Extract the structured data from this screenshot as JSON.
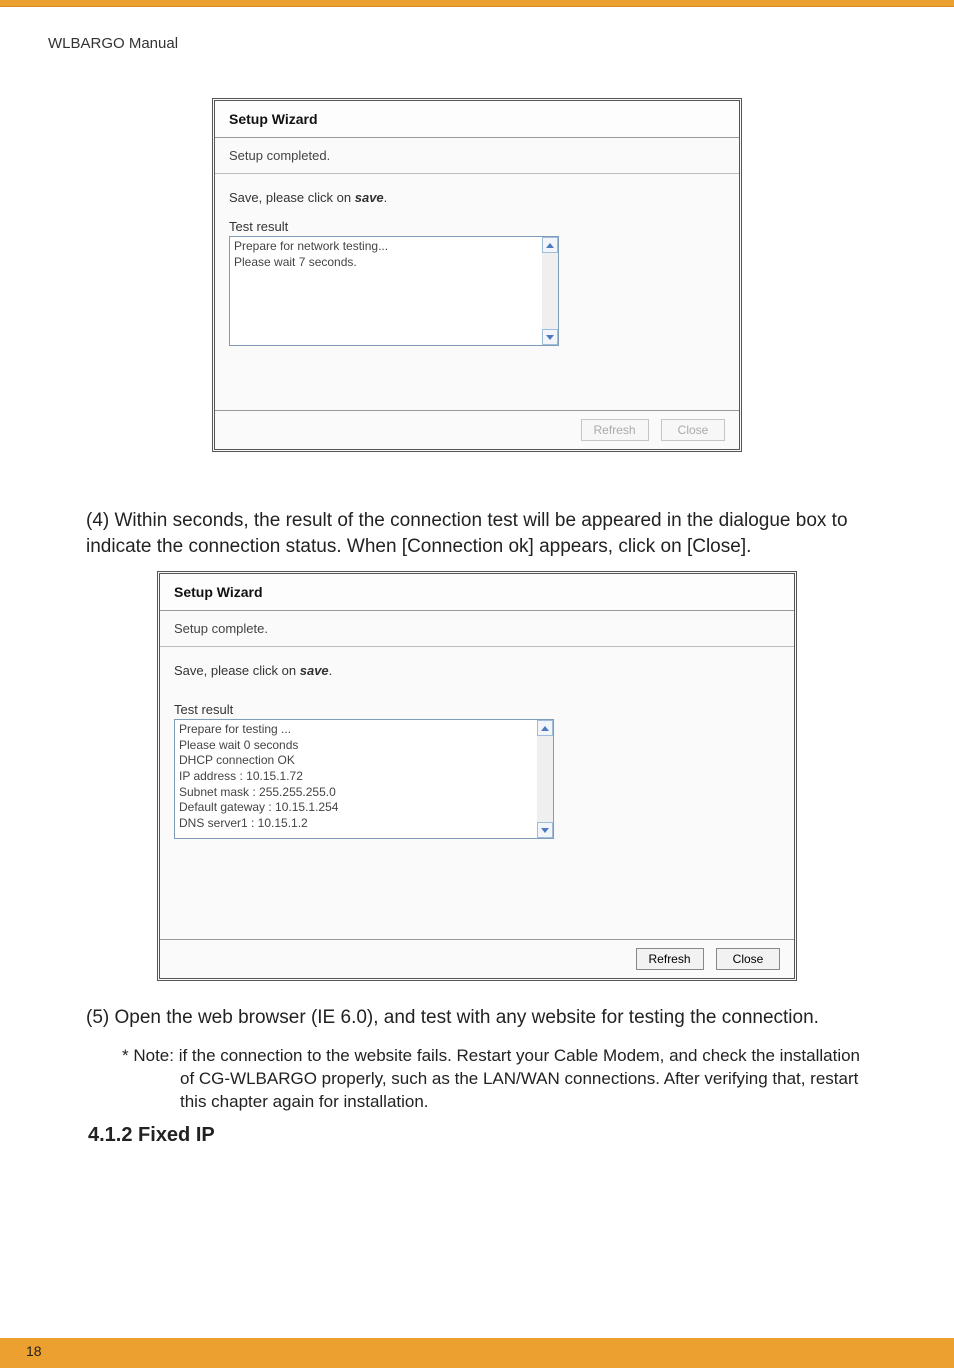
{
  "header": {
    "title": "WLBARGO Manual"
  },
  "wizard1": {
    "title": "Setup Wizard",
    "subtitle": "Setup completed.",
    "saveLinePrefix": "Save, please click on ",
    "saveWord": "save",
    "saveSuffix": ".",
    "testLabel": "Test result",
    "testContent": "Prepare for network testing...\nPlease wait  7  seconds.",
    "refreshLabel": "Refresh",
    "closeLabel": "Close"
  },
  "para4_prefix": "(4) ",
  "para4": "Within seconds, the result of the connection test will be appeared in the dialogue box to indicate the connection status. When [Connection ok] appears, click on [Close].",
  "wizard2": {
    "title": "Setup Wizard",
    "subtitle": "Setup complete.",
    "saveLinePrefix": "Save, please click on ",
    "saveWord": "save",
    "saveSuffix": ".",
    "testLabel": "Test result",
    "testContent": "Prepare for testing ...\nPlease wait 0 seconds\nDHCP connection OK\nIP address : 10.15.1.72\nSubnet mask : 255.255.255.0\nDefault gateway  : 10.15.1.254\nDNS server1 : 10.15.1.2",
    "refreshLabel": "Refresh",
    "closeLabel": "Close"
  },
  "para5_prefix": "(5) ",
  "para5": "Open the web browser (IE 6.0), and test with any website for testing the connection.",
  "note": "* Note: if the connection to the website fails. Restart your Cable Modem, and check the installation of CG-WLBARGO properly, such as the LAN/WAN connections. After verifying that, restart this chapter again for installation.",
  "sectionHeading": "4.1.2 Fixed IP",
  "pageNumber": "18",
  "chart_data": {
    "type": "table",
    "title": "DHCP Connection Test Result",
    "rows": [
      {
        "field": "DHCP connection",
        "value": "OK"
      },
      {
        "field": "IP address",
        "value": "10.15.1.72"
      },
      {
        "field": "Subnet mask",
        "value": "255.255.255.0"
      },
      {
        "field": "Default gateway",
        "value": "10.15.1.254"
      },
      {
        "field": "DNS server1",
        "value": "10.15.1.2"
      }
    ]
  }
}
